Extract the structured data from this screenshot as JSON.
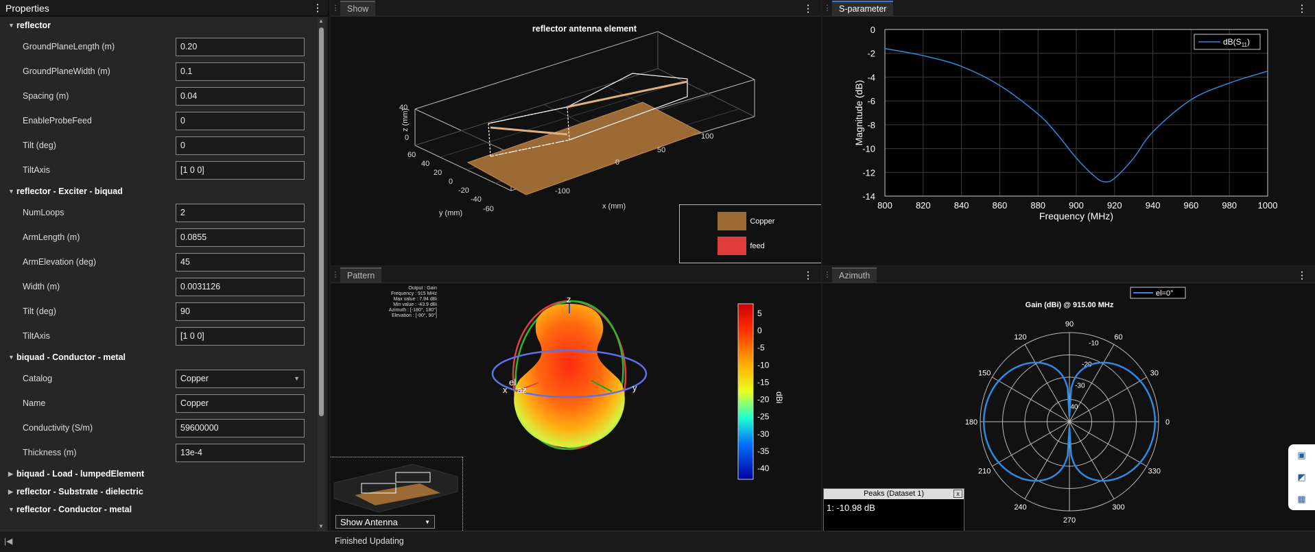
{
  "properties": {
    "title": "Properties",
    "sections": [
      {
        "label": "reflector",
        "expanded": true,
        "rows": [
          {
            "label": "GroundPlaneLength (m)",
            "value": "0.20"
          },
          {
            "label": "GroundPlaneWidth (m)",
            "value": "0.1"
          },
          {
            "label": "Spacing (m)",
            "value": "0.04"
          },
          {
            "label": "EnableProbeFeed",
            "value": "0"
          },
          {
            "label": "Tilt (deg)",
            "value": "0"
          },
          {
            "label": "TiltAxis",
            "value": "[1 0 0]"
          }
        ]
      },
      {
        "label": "reflector - Exciter - biquad",
        "expanded": true,
        "rows": [
          {
            "label": "NumLoops",
            "value": "2"
          },
          {
            "label": "ArmLength (m)",
            "value": "0.0855"
          },
          {
            "label": "ArmElevation (deg)",
            "value": "45"
          },
          {
            "label": "Width (m)",
            "value": "0.0031126"
          },
          {
            "label": "Tilt (deg)",
            "value": "90"
          },
          {
            "label": "TiltAxis",
            "value": "[1 0 0]"
          }
        ]
      },
      {
        "label": "biquad - Conductor - metal",
        "expanded": true,
        "rows": [
          {
            "label": "Catalog",
            "value": "Copper",
            "dropdown": true
          },
          {
            "label": "Name",
            "value": "Copper"
          },
          {
            "label": "Conductivity (S/m)",
            "value": "59600000"
          },
          {
            "label": "Thickness (m)",
            "value": "13e-4"
          }
        ]
      },
      {
        "label": "biquad - Load - lumpedElement",
        "expanded": false,
        "rows": []
      },
      {
        "label": "reflector - Substrate - dielectric",
        "expanded": false,
        "rows": []
      },
      {
        "label": "reflector - Conductor - metal",
        "expanded": true,
        "rows": []
      }
    ]
  },
  "show": {
    "tab": "Show",
    "title": "reflector antenna element",
    "xlabel": "x (mm)",
    "ylabel": "y (mm)",
    "zlabel": "z (mm)",
    "xticks": [
      "-100",
      "0",
      "50",
      "100"
    ],
    "yticks": [
      "60",
      "40",
      "20",
      "0",
      "-20",
      "-40",
      "-60"
    ],
    "zticks": [
      "40",
      "0"
    ],
    "legend": [
      {
        "label": "Copper",
        "color": "#9c6a35"
      },
      {
        "label": "feed",
        "color": "#e03c3c"
      }
    ]
  },
  "sparam": {
    "tab": "S-parameter",
    "legend_prefix": "dB(S",
    "legend_sub": "11",
    "legend_suffix": ")",
    "xlabel": "Frequency (MHz)",
    "ylabel": "Magnitude (dB)"
  },
  "chart_data": {
    "type": "line",
    "xlabel": "Frequency (MHz)",
    "ylabel": "Magnitude (dB)",
    "xlim": [
      800,
      1000
    ],
    "ylim": [
      -14,
      0
    ],
    "xticks": [
      800,
      820,
      840,
      860,
      880,
      900,
      920,
      940,
      960,
      980,
      1000
    ],
    "yticks": [
      0,
      -2,
      -4,
      -6,
      -8,
      -10,
      -12,
      -14
    ],
    "grid": true,
    "legend_position": "top-right",
    "series": [
      {
        "name": "dB(S11)",
        "color": "#2f8be0",
        "x": [
          800,
          820,
          840,
          860,
          880,
          890,
          900,
          910,
          915,
          920,
          930,
          940,
          960,
          980,
          1000
        ],
        "y": [
          -1.6,
          -2.2,
          -3.1,
          -4.7,
          -7.1,
          -8.8,
          -10.8,
          -12.4,
          -12.8,
          -12.5,
          -10.8,
          -8.6,
          -5.9,
          -4.5,
          -3.5
        ]
      }
    ]
  },
  "pattern": {
    "tab": "Pattern",
    "info": [
      "Output : Gain",
      "Frequency : 915 MHz",
      "Max value : 7.94 dBi",
      "Min value : -43.9 dBi",
      "Azimuth : [-180°, 180°]",
      "Elevation : [-90°, 90°]"
    ],
    "axis_z": "z",
    "axis_x": "x",
    "axis_y": "y",
    "axis_el": "el",
    "axis_az": "az",
    "colorbar_label": "dBi",
    "colorbar_ticks": [
      "5",
      "0",
      "-5",
      "-10",
      "-15",
      "-20",
      "-25",
      "-30",
      "-35",
      "-40"
    ],
    "show_antenna": "Show Antenna"
  },
  "azimuth": {
    "tab": "Azimuth",
    "title": "Gain (dBi) @ 915.00 MHz",
    "legend": "el=0°",
    "angle_labels": [
      "0",
      "30",
      "60",
      "90",
      "120",
      "150",
      "180",
      "210",
      "240",
      "270",
      "300",
      "330"
    ],
    "radial_labels": [
      "-10",
      "-20",
      "-30",
      "-40"
    ],
    "peaks_title": "Peaks (Dataset 1)",
    "peaks_close": "x",
    "peaks_value": "1: -10.98 dB"
  },
  "status": {
    "text": "Finished Updating"
  },
  "icons": {
    "kebab": "⋮",
    "grip": "⋮"
  }
}
